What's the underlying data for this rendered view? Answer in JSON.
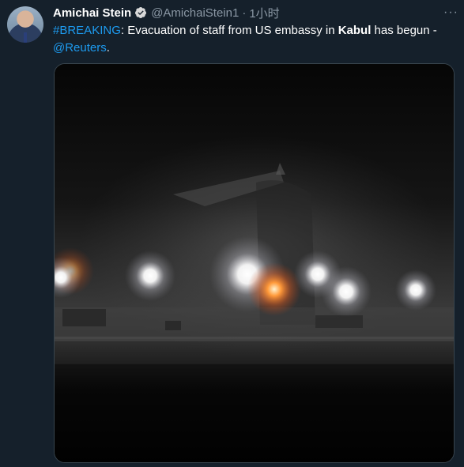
{
  "tweet": {
    "author_name": "Amichai Stein",
    "handle": "@AmichaiStein1",
    "separator": "·",
    "time": "1小时",
    "more_label": "···",
    "hashtag": "#BREAKING",
    "text_part1": ": Evacuation of staff from US embassy in ",
    "text_bold": "Kabul",
    "text_part2": " has begun -",
    "mention": "@Reuters",
    "text_end": "."
  },
  "colors": {
    "background": "#15202b",
    "link": "#1d9bf0",
    "secondary_text": "#8b98a5",
    "verified_badge": "#d9d9d9"
  },
  "icons": {
    "verified": "verified-badge-icon",
    "more": "more-options-icon"
  }
}
